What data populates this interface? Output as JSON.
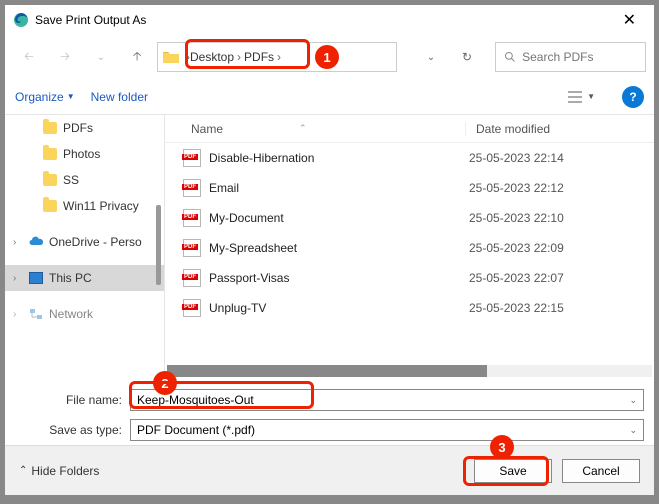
{
  "title": "Save Print Output As",
  "breadcrumb": {
    "a": "Desktop",
    "b": "PDFs"
  },
  "search": {
    "placeholder": "Search PDFs"
  },
  "toolbar": {
    "organize": "Organize",
    "newfolder": "New folder"
  },
  "tree": {
    "pdfs": "PDFs",
    "photos": "Photos",
    "ss": "SS",
    "win11": "Win11 Privacy",
    "onedrive": "OneDrive - Perso",
    "thispc": "This PC",
    "network": "Network"
  },
  "cols": {
    "name": "Name",
    "date": "Date modified"
  },
  "files": [
    {
      "name": "Disable-Hibernation",
      "date": "25-05-2023 22:14"
    },
    {
      "name": "Email",
      "date": "25-05-2023 22:12"
    },
    {
      "name": "My-Document",
      "date": "25-05-2023 22:10"
    },
    {
      "name": "My-Spreadsheet",
      "date": "25-05-2023 22:09"
    },
    {
      "name": "Passport-Visas",
      "date": "25-05-2023 22:07"
    },
    {
      "name": "Unplug-TV",
      "date": "25-05-2023 22:15"
    }
  ],
  "form": {
    "filename_label": "File name:",
    "filename_value": "Keep-Mosquitoes-Out",
    "saveas_label": "Save as type:",
    "saveas_value": "PDF Document (*.pdf)"
  },
  "footer": {
    "hide": "Hide Folders",
    "save": "Save",
    "cancel": "Cancel"
  },
  "ann": {
    "n1": "1",
    "n2": "2",
    "n3": "3"
  }
}
